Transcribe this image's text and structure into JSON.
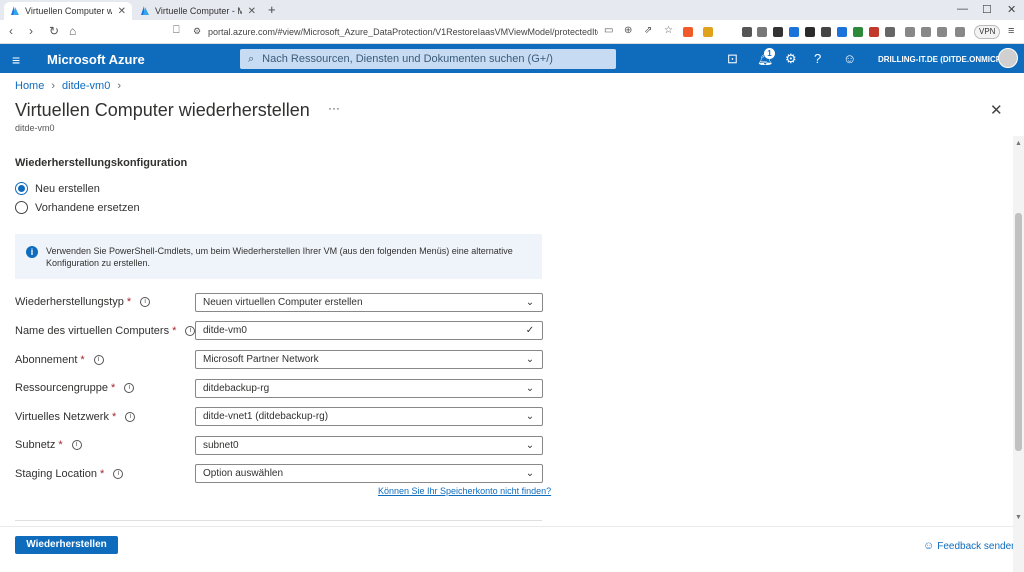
{
  "browser": {
    "tabs": [
      {
        "label": "Virtuellen Computer wiederherstellen",
        "active": true
      },
      {
        "label": "Virtuelle Computer - Microsoft Azure",
        "active": false
      }
    ],
    "url": "portal.azure.com/#view/Microsoft_Azure_DataProtection/V1RestoreIaasVMViewModel/protectedItemId/%2Fsubsc...",
    "vpn_label": "VPN"
  },
  "azure": {
    "brand": "Microsoft Azure",
    "search_placeholder": "Nach Ressourcen, Diensten und Dokumenten suchen (G+/)",
    "notification_count": "1",
    "account": "DRILLING-IT.DE (DITDE.ONMICR..."
  },
  "breadcrumb": [
    "Home",
    "ditde-vm0"
  ],
  "page": {
    "title": "Virtuellen Computer wiederherstellen",
    "ellipsis": "···",
    "subtitle": "ditde-vm0",
    "section_title": "Wiederherstellungskonfiguration"
  },
  "radios": [
    {
      "label": "Neu erstellen",
      "checked": true
    },
    {
      "label": "Vorhandene ersetzen",
      "checked": false
    }
  ],
  "info": "Verwenden Sie PowerShell-Cmdlets, um beim Wiederherstellen Ihrer VM (aus den folgenden Menüs) eine alternative Konfiguration zu erstellen.",
  "fields": [
    {
      "label": "Wiederherstellungstyp",
      "value": "Neuen virtuellen Computer erstellen",
      "chev": "⌄"
    },
    {
      "label": "Name des virtuellen Computers",
      "value": "ditde-vm0",
      "chev": "✓"
    },
    {
      "label": "Abonnement",
      "value": "Microsoft Partner Network",
      "chev": "⌄"
    },
    {
      "label": "Ressourcengruppe",
      "value": "ditdebackup-rg",
      "chev": "⌄"
    },
    {
      "label": "Virtuelles Netzwerk",
      "value": "ditde-vnet1 (ditdebackup-rg)",
      "chev": "⌄"
    },
    {
      "label": "Subnetz",
      "value": "subnet0",
      "chev": "⌄"
    },
    {
      "label": "Staging Location",
      "value": "Option auswählen",
      "chev": "⌄"
    }
  ],
  "find_link": "Können Sie Ihr Speicherkonto nicht finden?",
  "footer": {
    "restore_button": "Wiederherstellen",
    "feedback": "Feedback senden"
  },
  "colors": {
    "azure_blue": "#0f6cbd",
    "required": "#a4262c",
    "info_bg": "#eff4fa"
  }
}
